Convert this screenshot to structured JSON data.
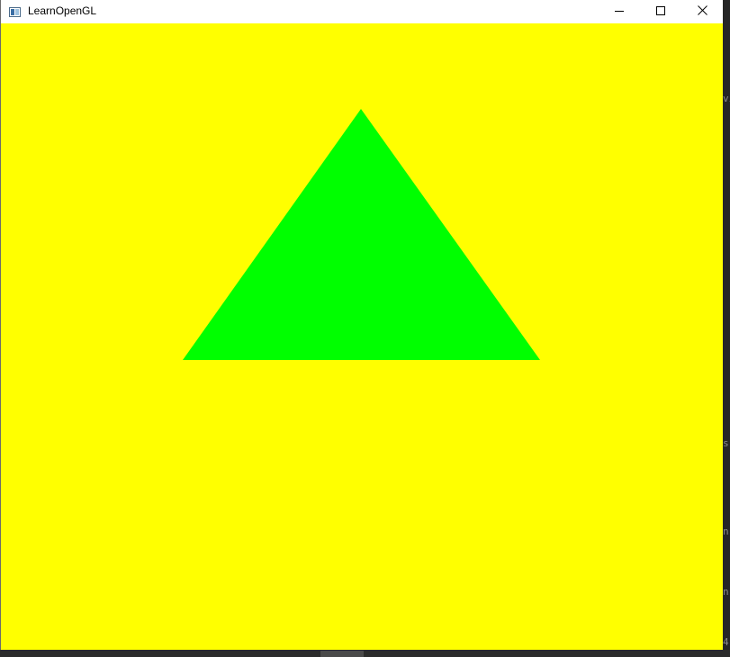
{
  "window": {
    "title": "LearnOpenGL",
    "icons": {
      "app": "window-app-icon",
      "minimize": "minimize-icon",
      "maximize": "maximize-icon",
      "close": "close-icon"
    }
  },
  "scene": {
    "clear_color": "#ffff00",
    "triangle_color": "#00ff00"
  },
  "background_editor": {
    "glyphs": [
      "vi",
      "s",
      "n",
      "n",
      "4"
    ]
  }
}
